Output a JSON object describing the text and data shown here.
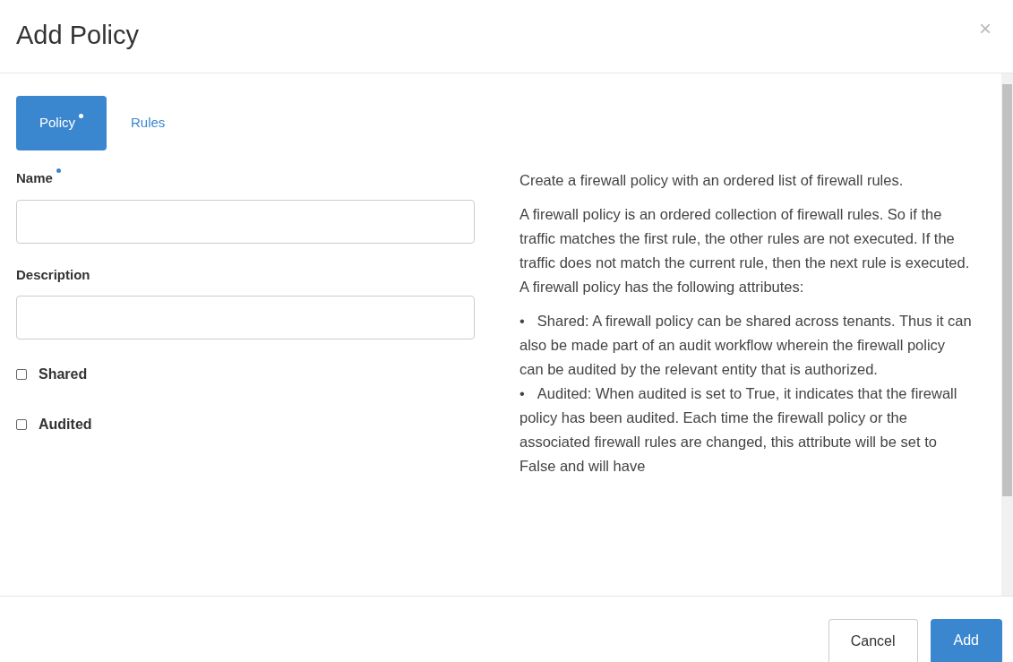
{
  "dialog": {
    "title": "Add Policy",
    "close": "×"
  },
  "tabs": [
    {
      "label": "Policy",
      "required": true,
      "selected": true
    },
    {
      "label": "Rules",
      "required": false,
      "selected": false
    }
  ],
  "fields": [
    {
      "kind": "text",
      "label": "Name",
      "required": true
    },
    {
      "kind": "text",
      "label": "Description",
      "required": false
    },
    {
      "kind": "checkbox",
      "label": "Shared",
      "checked": false
    },
    {
      "kind": "checkbox",
      "label": "Audited",
      "checked": false
    }
  ],
  "help": {
    "paragraphs": [
      "Create a firewall policy with an ordered list of firewall rules.",
      "A firewall policy is an ordered collection of firewall rules. So if the traffic matches the first rule, the other rules are not executed. If the traffic does not match the current rule, then the next rule is executed. A firewall policy has the following attributes:"
    ],
    "bullets": [
      {
        "marker": "•",
        "text": "Shared: A firewall policy can be shared across tenants. Thus it can also be made part of an audit workflow wherein the firewall policy can be audited by the relevant entity that is authorized."
      },
      {
        "marker": "•",
        "text": "Audited: When audited is set to True, it indicates that the firewall policy has been audited. Each time the firewall policy or the associated firewall rules are changed, this attribute will be set to False and will have"
      }
    ]
  },
  "buttons": [
    {
      "kind": "default",
      "label": "Cancel"
    },
    {
      "kind": "primary",
      "label": "Add"
    }
  ]
}
